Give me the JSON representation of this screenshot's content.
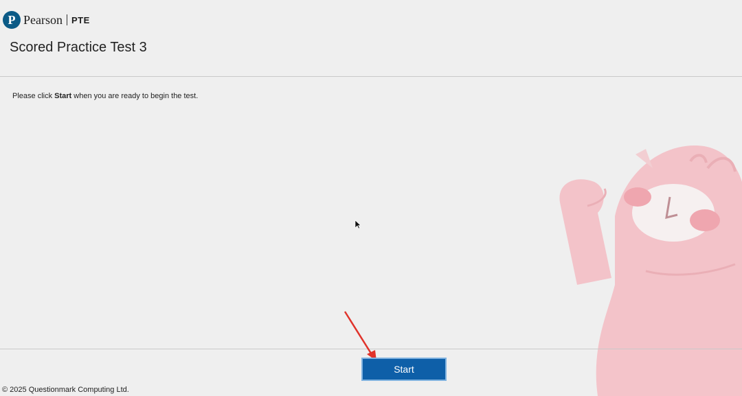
{
  "header": {
    "logo_letter": "P",
    "brand_name": "Pearson",
    "product": "PTE"
  },
  "page_title": "Scored Practice Test 3",
  "instruction": {
    "before": "Please click ",
    "bold": "Start",
    "after": " when you are ready to begin the test."
  },
  "start_button": {
    "label": "Start"
  },
  "footer": {
    "copyright": "© 2025 Questionmark Computing Ltd."
  },
  "colors": {
    "background": "#efefef",
    "brand_blue": "#0b5a86",
    "button_blue": "#0e5fa8",
    "annotation_arrow": "#e0332b",
    "mascot_pink": "#f2b3bb"
  }
}
